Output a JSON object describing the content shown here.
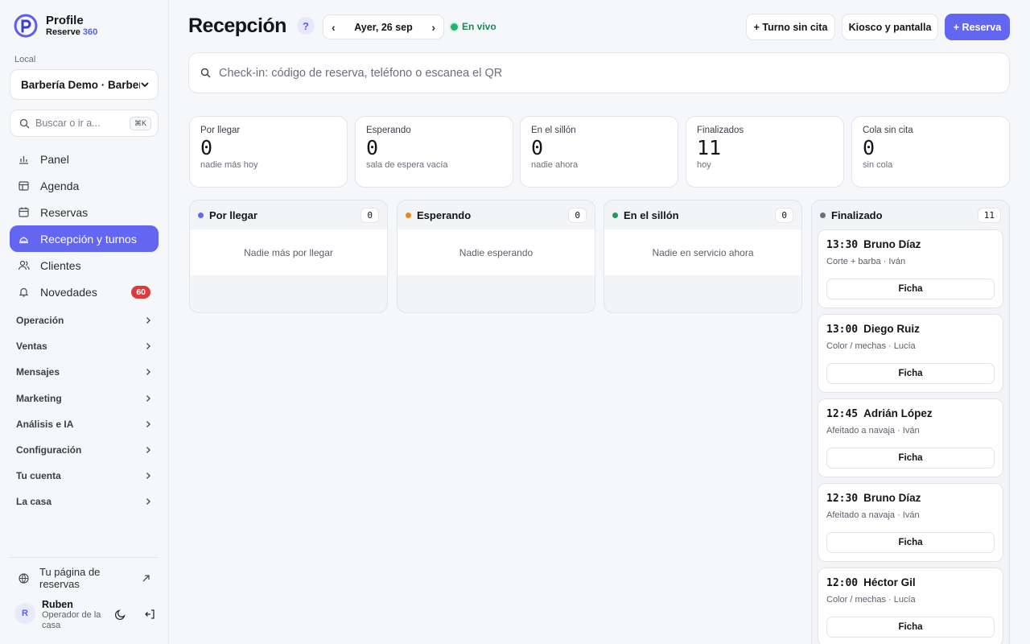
{
  "brand": {
    "name": "Profile",
    "sub_prefix": "Reserve ",
    "sub_accent": "360"
  },
  "local": {
    "label": "Local",
    "value": "Barbería Demo · Barbería"
  },
  "search": {
    "placeholder": "Buscar o ir a...",
    "shortcut": "⌘K"
  },
  "nav": [
    {
      "label": "Panel",
      "icon": "bar-chart-icon"
    },
    {
      "label": "Agenda",
      "icon": "calendar-grid-icon"
    },
    {
      "label": "Reservas",
      "icon": "calendar-icon"
    },
    {
      "label": "Recepción y turnos",
      "icon": "bell-desk-icon",
      "active": true
    },
    {
      "label": "Clientes",
      "icon": "users-icon"
    },
    {
      "label": "Novedades",
      "icon": "bell-icon",
      "badge": "60"
    }
  ],
  "groups": [
    "Operación",
    "Ventas",
    "Mensajes",
    "Marketing",
    "Análisis e IA",
    "Configuración",
    "Tu cuenta",
    "La casa"
  ],
  "public_link": {
    "label": "Tu página de reservas"
  },
  "user": {
    "initial": "R",
    "name": "Ruben",
    "role": "Operador de la casa"
  },
  "header": {
    "title": "Recepción",
    "help": "?",
    "date": "Ayer, 26 sep",
    "prev": "‹",
    "next": "›",
    "live": "En vivo",
    "btn_walkin": "+ Turno sin cita",
    "btn_kiosk": "Kiosco y pantalla",
    "btn_reserve": "+ Reserva"
  },
  "checkin": {
    "placeholder": "Check-in: código de reserva, teléfono o escanea el QR"
  },
  "stats": [
    {
      "label": "Por llegar",
      "value": "0",
      "sub": "nadie más hoy"
    },
    {
      "label": "Esperando",
      "value": "0",
      "sub": "sala de espera vacía"
    },
    {
      "label": "En el sillón",
      "value": "0",
      "sub": "nadie ahora"
    },
    {
      "label": "Finalizados",
      "value": "11",
      "sub": "hoy"
    },
    {
      "label": "Cola sin cita",
      "value": "0",
      "sub": "sin cola"
    }
  ],
  "columns": [
    {
      "title": "Por llegar",
      "count": "0",
      "empty": "Nadie más por llegar",
      "color": "#6366f1"
    },
    {
      "title": "Esperando",
      "count": "0",
      "empty": "Nadie esperando",
      "color": "#e08a1e"
    },
    {
      "title": "En el sillón",
      "count": "0",
      "empty": "Nadie en servicio ahora",
      "color": "#1f9d5c"
    }
  ],
  "finalizado": {
    "title": "Finalizado",
    "count": "11",
    "color": "#6b6f7b",
    "cards": [
      {
        "time": "13:30",
        "name": "Bruno Díaz",
        "service": "Corte + barba · Iván",
        "action": "Ficha"
      },
      {
        "time": "13:00",
        "name": "Diego Ruiz",
        "service": "Color / mechas · Lucía",
        "action": "Ficha"
      },
      {
        "time": "12:45",
        "name": "Adrián López",
        "service": "Afeitado a navaja · Iván",
        "action": "Ficha"
      },
      {
        "time": "12:30",
        "name": "Bruno Díaz",
        "service": "Afeitado a navaja · Iván",
        "action": "Ficha"
      },
      {
        "time": "12:00",
        "name": "Héctor Gil",
        "service": "Color / mechas · Lucía",
        "action": "Ficha"
      }
    ]
  },
  "colors": {
    "accent": "#6366f1",
    "live": "#22b36e",
    "badge": "#dc3b3b"
  }
}
